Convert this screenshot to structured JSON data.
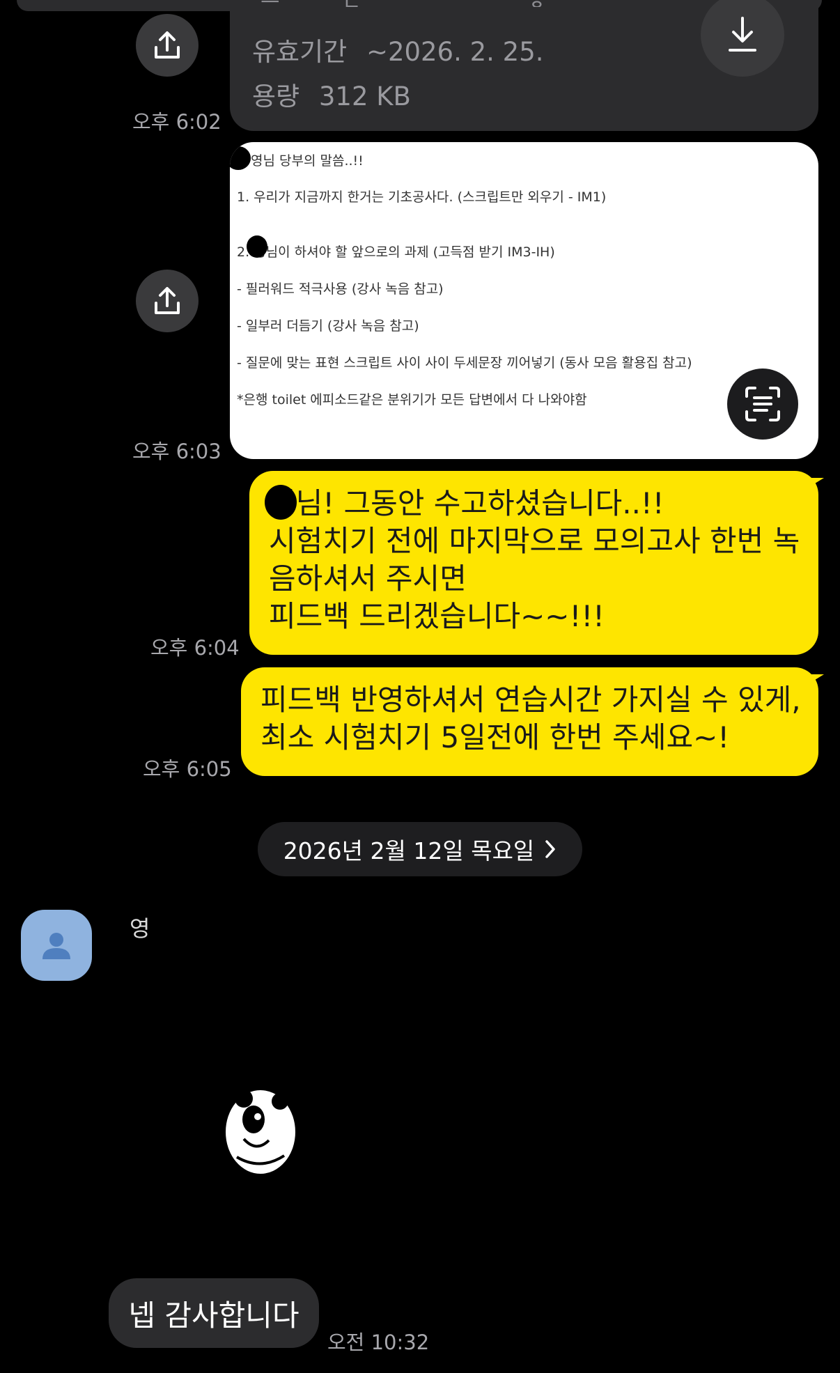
{
  "file_attachment": {
    "cut_text": "ㅡ ㄷ .. ㅎ",
    "expiry_label": "유효기간",
    "expiry_value": "~2026. 2. 25.",
    "size_label": "용량",
    "size_value": "312 KB",
    "time": "오후 6:02"
  },
  "image_message": {
    "time": "오후 6:03",
    "lines": [
      "영님 당부의 말씀..!!",
      "1. 우리가 지금까지 한거는 기초공사다. (스크립트만 외우기 - IM1)",
      "2.  영님이 하셔야 할 앞으로의 과제 (고득점 받기 IM3-IH)",
      "- 필러워드 적극사용 (강사 녹음 참고)",
      "- 일부러 더듬기 (강사 녹음 참고)",
      "- 질문에 맞는 표현 스크립트 사이 사이 두세문장 끼어넣기 (동사 모음 활용집 참고)",
      "*은행 toilet 에피소드같은 분위기가 모든 답변에서 다 나와야함"
    ]
  },
  "my_messages": [
    {
      "time": "오후 6:04",
      "lines": [
        "영님! 그동안 수고하셨습니다..!!",
        "시험치기 전에 마지막으로 모의고사 한번 녹",
        "음하셔서 주시면",
        "피드백 드리겠습니다~~!!!"
      ]
    },
    {
      "time": "오후 6:05",
      "lines": [
        "피드백 반영하셔서 연습시간 가지실 수 있게,",
        "최소 시험치기 5일전에 한번 주세요~!"
      ]
    }
  ],
  "date_divider": "2026년 2월 12일 목요일",
  "incoming": {
    "sender_name": "영",
    "reply_text": "넵 감사합니다",
    "reply_time": "오전 10:32"
  },
  "colors": {
    "background": "#000000",
    "my_bubble": "#fee500",
    "other_bubble": "#2c2c2e",
    "avatar": "#8fb3df"
  },
  "icons": [
    "share-icon",
    "download-icon",
    "text-scan-icon",
    "chevron-right-icon",
    "person-icon",
    "panda-sticker"
  ]
}
